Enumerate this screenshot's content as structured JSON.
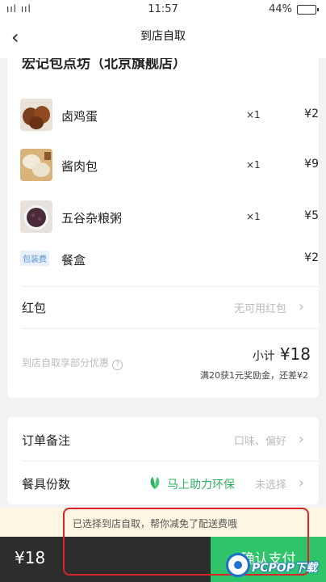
{
  "status_bar": {
    "signal": "ııl ııl",
    "time": "11:57",
    "battery": "44%"
  },
  "nav": {
    "back": "‹",
    "title": "到店自取"
  },
  "store": {
    "name": "宏记包点坊（北京旗舰店）"
  },
  "items": [
    {
      "name": "卤鸡蛋",
      "qty": "×1",
      "price": "¥2"
    },
    {
      "name": "酱肉包",
      "qty": "×1",
      "price": "¥9"
    },
    {
      "name": "五谷杂粮粥",
      "qty": "×1",
      "price": "¥5"
    }
  ],
  "packaging": {
    "tag": "包装费",
    "name": "餐盒",
    "price": "¥2"
  },
  "red_packet": {
    "label": "红包",
    "value": "无可用红包",
    "chevron": "›"
  },
  "discount": {
    "text": "到店自取享部分优惠",
    "help": "?"
  },
  "subtotal": {
    "label": "小计",
    "amount": "¥18",
    "reward": "满20获1元奖励金，还差¥2"
  },
  "remarks": {
    "label": "订单备注",
    "value": "口味、偏好",
    "chevron": "›"
  },
  "tableware": {
    "label": "餐具份数",
    "eco": "马上助力环保",
    "value": "未选择",
    "chevron": "›"
  },
  "notice": {
    "text": "已选择到店自取，帮你减免了配送费哦"
  },
  "footer": {
    "total": "¥18",
    "pay": "确认支付"
  },
  "watermark": {
    "text": "PCPOP下载"
  },
  "colors": {
    "green": "#2fc46a",
    "dark": "#2d2d2d",
    "highlight": "#d8232a",
    "notice_bg": "#fdf6e2"
  }
}
